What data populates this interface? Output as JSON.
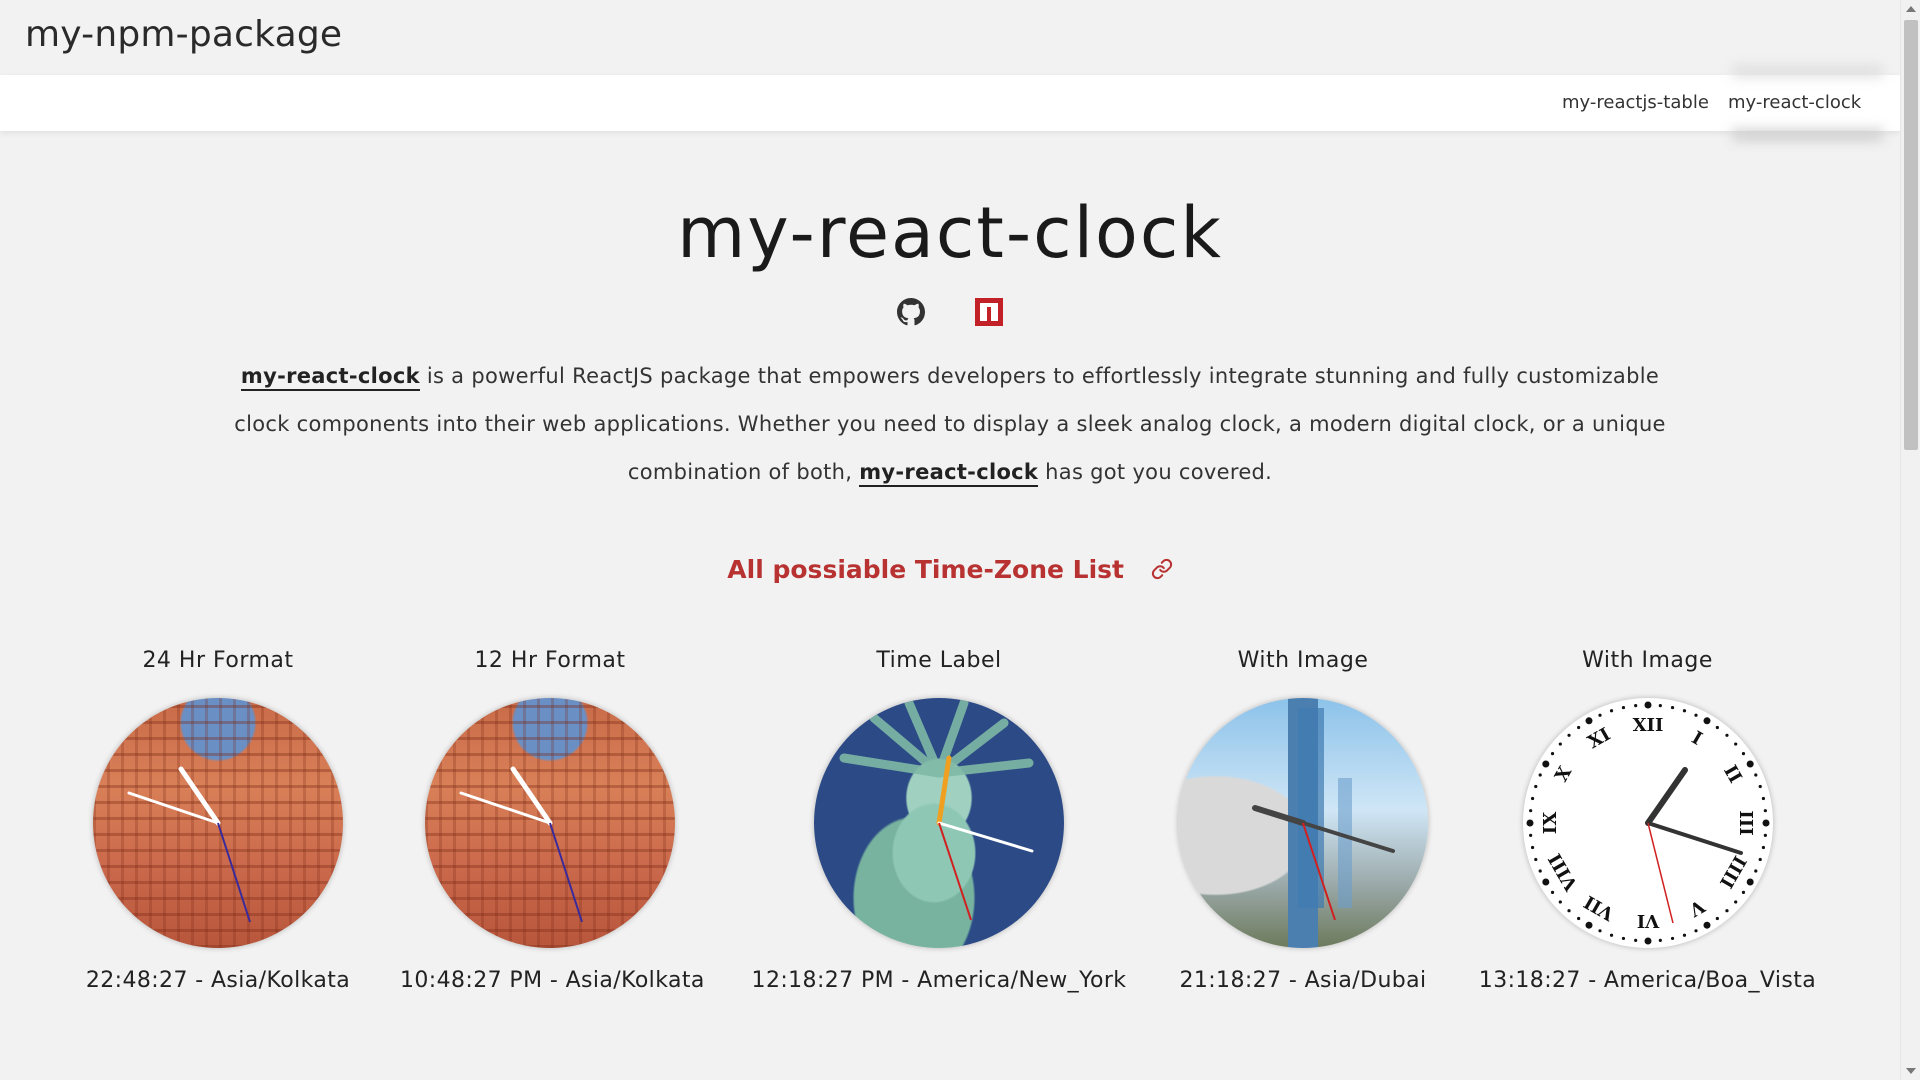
{
  "brand": "my-npm-package",
  "nav": {
    "items": [
      {
        "label": "my-reactjs-table"
      },
      {
        "label": "my-react-clock"
      }
    ]
  },
  "header": {
    "title": "my-react-clock"
  },
  "description": {
    "pkg_name": "my-react-clock",
    "part1": " is a powerful ReactJS package that empowers developers to effortlessly integrate stunning and fully customizable clock components into their web applications. Whether you need to display a sleek analog clock, a modern digital clock, or a unique combination of both, ",
    "part2": " has got you covered."
  },
  "timezone_link": {
    "label": "All possiable Time-Zone List"
  },
  "clocks": [
    {
      "label": "24 Hr Format",
      "time": "22:48:27 - Asia/Kolkata",
      "image": "hawa-mahal-palace"
    },
    {
      "label": "12 Hr Format",
      "time": "10:48:27 PM - Asia/Kolkata",
      "image": "hawa-mahal-palace"
    },
    {
      "label": "Time Label",
      "time": "12:18:27 PM - America/New_York",
      "image": "statue-of-liberty"
    },
    {
      "label": "With Image",
      "time": "21:18:27 - Asia/Dubai",
      "image": "dubai-skyline"
    },
    {
      "label": "With Image",
      "time": "13:18:27 - America/Boa_Vista",
      "image": "roman-numeral-face"
    }
  ],
  "colors": {
    "accent_red": "#b83232",
    "npm_red": "#c12127"
  }
}
